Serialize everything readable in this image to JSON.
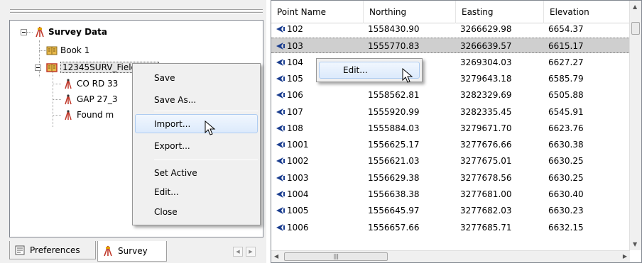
{
  "tree": {
    "root": {
      "label": "Survey Data",
      "icon": "surveyor-tripod-icon"
    },
    "children": [
      {
        "label": "Book 1",
        "icon": "fieldbook-icon"
      },
      {
        "label": "12345SURV_Fieldbook",
        "label_visible": "12345SURV_Fieldbook",
        "icon": "fieldbook-icon",
        "selected": true,
        "children": [
          {
            "label": "CO RD 33",
            "icon": "survey-point-icon"
          },
          {
            "label": "GAP 27_3",
            "icon": "survey-point-icon"
          },
          {
            "label": "Found m",
            "icon": "survey-point-icon"
          }
        ]
      }
    ]
  },
  "context_menu": {
    "items": [
      "Save",
      "Save As...",
      "Import...",
      "Export...",
      "Set Active",
      "Edit...",
      "Close"
    ],
    "highlighted": "Import..."
  },
  "bottom_tabs": [
    {
      "label": "Preferences",
      "icon": "preferences-icon"
    },
    {
      "label": "Survey",
      "icon": "survey-icon",
      "active": true
    }
  ],
  "grid": {
    "columns": [
      "Point Name",
      "Northing",
      "Easting",
      "Elevation"
    ],
    "rows": [
      {
        "name": "102",
        "northing": "1558430.90",
        "easting": "3266629.98",
        "elevation": "6654.37"
      },
      {
        "name": "103",
        "northing": "1555770.83",
        "easting": "3266639.57",
        "elevation": "6615.17",
        "selected": true
      },
      {
        "name": "104",
        "northing": "",
        "easting": "3269304.03",
        "elevation": "6627.27"
      },
      {
        "name": "105",
        "northing": "1558527.87",
        "easting": "3279643.18",
        "elevation": "6585.79"
      },
      {
        "name": "106",
        "northing": "1558562.81",
        "easting": "3282329.69",
        "elevation": "6505.88"
      },
      {
        "name": "107",
        "northing": "1555920.99",
        "easting": "3282335.45",
        "elevation": "6545.91"
      },
      {
        "name": "108",
        "northing": "1555884.03",
        "easting": "3279671.70",
        "elevation": "6623.76"
      },
      {
        "name": "1001",
        "northing": "1556625.17",
        "easting": "3277676.66",
        "elevation": "6630.38"
      },
      {
        "name": "1002",
        "northing": "1556621.03",
        "easting": "3277675.01",
        "elevation": "6630.25"
      },
      {
        "name": "1003",
        "northing": "1556629.38",
        "easting": "3277678.56",
        "elevation": "6630.25"
      },
      {
        "name": "1004",
        "northing": "1556638.38",
        "easting": "3277681.00",
        "elevation": "6630.40"
      },
      {
        "name": "1005",
        "northing": "1556645.97",
        "easting": "3277682.03",
        "elevation": "6630.23"
      },
      {
        "name": "1006",
        "northing": "1556657.66",
        "easting": "3277685.71",
        "elevation": "6632.15"
      }
    ]
  },
  "grid_context_menu": {
    "items": [
      "Edit..."
    ]
  },
  "colors": {
    "highlight_border": "#aeccf1",
    "selected_row": "#cfcfcf",
    "tripod": "#c0392b",
    "point_icon": "#1a3d8f"
  }
}
